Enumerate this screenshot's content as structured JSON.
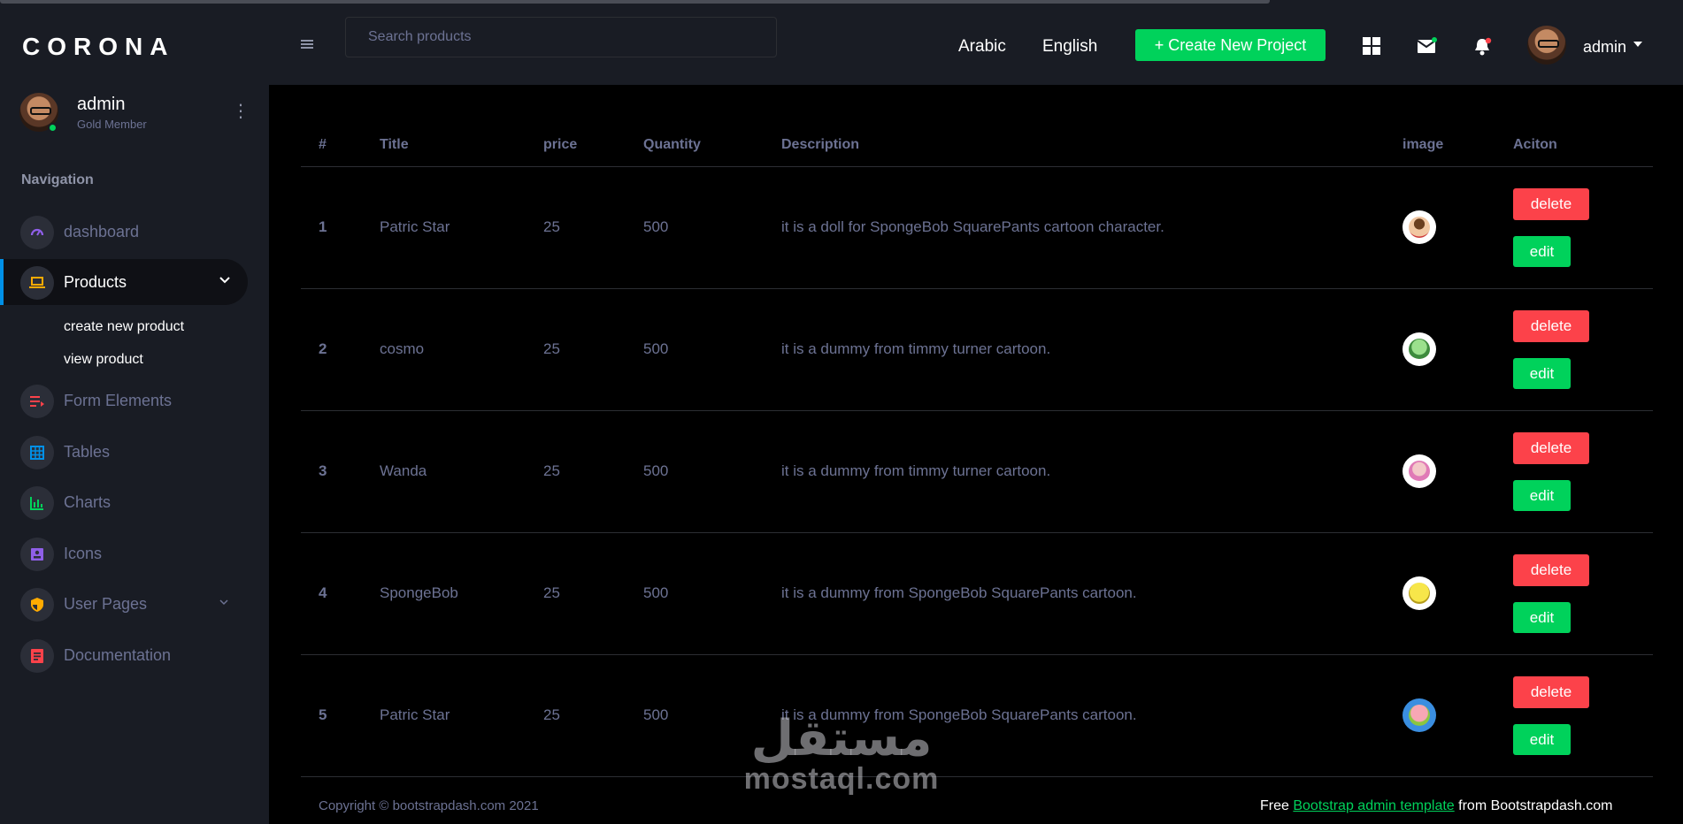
{
  "brand": "CORONA",
  "profile": {
    "name": "admin",
    "role": "Gold Member"
  },
  "navigation": {
    "heading": "Navigation",
    "items": [
      {
        "label": "dashboard",
        "icon": "speedometer-icon",
        "color": "#8f5fe8"
      },
      {
        "label": "Products",
        "icon": "laptop-icon",
        "color": "#ffab00",
        "active": true
      },
      {
        "label": "Form Elements",
        "icon": "playlist-icon",
        "color": "#fc424a"
      },
      {
        "label": "Tables",
        "icon": "table-icon",
        "color": "#0090e7"
      },
      {
        "label": "Charts",
        "icon": "chart-bar-icon",
        "color": "#00d25b"
      },
      {
        "label": "Icons",
        "icon": "contacts-icon",
        "color": "#8f5fe8"
      },
      {
        "label": "User Pages",
        "icon": "security-icon",
        "color": "#ffab00"
      },
      {
        "label": "Documentation",
        "icon": "file-document-icon",
        "color": "#fc424a"
      }
    ],
    "sub_items": [
      "create new product",
      "view product"
    ]
  },
  "navbar": {
    "search_placeholder": "Search products",
    "lang_ar": "Arabic",
    "lang_en": "English",
    "create_label": "+ Create New Project",
    "user": "admin"
  },
  "table": {
    "headers": [
      "#",
      "Title",
      "price",
      "Quantity",
      "Description",
      "image",
      "Aciton"
    ],
    "rows": [
      {
        "num": "1",
        "title": "Patric Star",
        "price": "25",
        "qty": "500",
        "desc": "it is a doll for SpongeBob SquarePants cartoon character.",
        "img": "timmy"
      },
      {
        "num": "2",
        "title": "cosmo",
        "price": "25",
        "qty": "500",
        "desc": "it is a dummy from timmy turner cartoon.",
        "img": "cosmo"
      },
      {
        "num": "3",
        "title": "Wanda",
        "price": "25",
        "qty": "500",
        "desc": "it is a dummy from timmy turner cartoon.",
        "img": "wanda"
      },
      {
        "num": "4",
        "title": "SpongeBob",
        "price": "25",
        "qty": "500",
        "desc": "it is a dummy from SpongeBob SquarePants cartoon.",
        "img": "spongebob"
      },
      {
        "num": "5",
        "title": "Patric Star",
        "price": "25",
        "qty": "500",
        "desc": "it is a dummy from SpongeBob SquarePants cartoon.",
        "img": "patrick"
      }
    ],
    "delete_label": "delete",
    "edit_label": "edit"
  },
  "footer": {
    "copyright": "Copyright © bootstrapdash.com 2021",
    "free_prefix": "Free",
    "link_text": "Bootstrap admin template",
    "suffix": "from Bootstrapdash.com"
  },
  "watermark": {
    "arabic": "مستقل",
    "latin": "mostaql.com"
  }
}
